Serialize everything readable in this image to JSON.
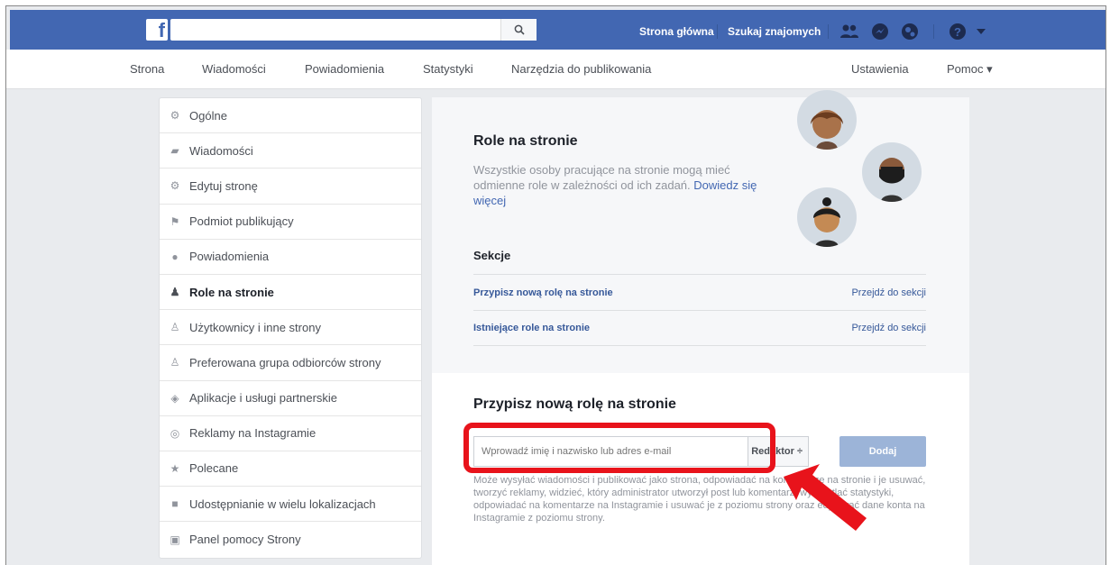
{
  "topbar": {
    "logo": "f",
    "search_placeholder": "",
    "links": [
      "Strona główna",
      "Szukaj znajomych"
    ]
  },
  "pagenav": {
    "items": [
      "Strona",
      "Wiadomości",
      "Powiadomienia",
      "Statystyki",
      "Narzędzia do publikowania"
    ],
    "settings": "Ustawienia",
    "help": "Pomoc ▾"
  },
  "sidebar": {
    "items": [
      {
        "label": "Ogólne",
        "icon": "gear-icon"
      },
      {
        "label": "Wiadomości",
        "icon": "messages-icon"
      },
      {
        "label": "Edytuj stronę",
        "icon": "gear-icon"
      },
      {
        "label": "Podmiot publikujący",
        "icon": "flag-icon"
      },
      {
        "label": "Powiadomienia",
        "icon": "globe-icon"
      },
      {
        "label": "Role na stronie",
        "icon": "person-icon"
      },
      {
        "label": "Użytkownicy i inne strony",
        "icon": "person-add-icon"
      },
      {
        "label": "Preferowana grupa odbiorców strony",
        "icon": "person-add-icon"
      },
      {
        "label": "Aplikacje i usługi partnerskie",
        "icon": "cube-icon"
      },
      {
        "label": "Reklamy na Instagramie",
        "icon": "instagram-icon"
      },
      {
        "label": "Polecane",
        "icon": "star-icon"
      },
      {
        "label": "Udostępnianie w wielu lokalizacjach",
        "icon": "video-icon"
      },
      {
        "label": "Panel pomocy Strony",
        "icon": "facebook-icon"
      }
    ]
  },
  "main": {
    "roles_title": "Role na stronie",
    "roles_desc": "Wszystkie osoby pracujące na stronie mogą mieć odmienne role w zależności od ich zadań.",
    "roles_link": "Dowiedz się więcej",
    "sections_title": "Sekcje",
    "sections": [
      {
        "label": "Przypisz nową rolę na stronie",
        "go": "Przejdź do sekcji"
      },
      {
        "label": "Istniejące role na stronie",
        "go": "Przejdź do sekcji"
      }
    ],
    "assign_title": "Przypisz nową rolę na stronie",
    "input_placeholder": "Wprowadź imię i nazwisko lub adres e-mail",
    "role_select": "Redaktor ÷",
    "add_button": "Dodaj",
    "role_desc": "Może wysyłać wiadomości i publikować jako strona, odpowiadać na komentarze na stronie i je usuwać, tworzyć reklamy, widzieć, który administrator utworzył post lub komentarz, wyświetlać statystyki, odpowiadać na komentarze na Instagramie i usuwać je z poziomu strony oraz edytować dane konta na Instagramie z poziomu strony."
  }
}
